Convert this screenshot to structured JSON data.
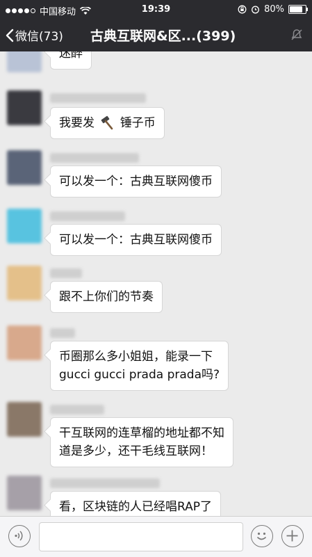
{
  "status_bar": {
    "carrier": "中国移动",
    "time": "19:39",
    "battery": "80%",
    "battery_level": 0.8,
    "signal_bars": 4
  },
  "nav": {
    "back_label": "微信(73)",
    "title": "古典互联网&区...(399)"
  },
  "messages": [
    {
      "text": "迷醉",
      "avatar_color": "#b9c3d6"
    },
    {
      "text": "我要发",
      "text_after_icon": "锤子币",
      "icon": "hammer-icon",
      "avatar_color": "#3a3a40"
    },
    {
      "text": "可以发一个：古典互联网傻币",
      "avatar_color": "#5a6478"
    },
    {
      "text": "可以发一个：古典互联网傻币",
      "avatar_color": "#58c3e0"
    },
    {
      "text": "跟不上你们的节奏",
      "avatar_color": "#e4c08a"
    },
    {
      "text": "币圈那么多小姐姐，能录一下",
      "line2": "gucci gucci prada prada吗?",
      "avatar_color": "#d8a98c"
    },
    {
      "text": "干互联网的连草榴的地址都不知",
      "line2": "道是多少，还干毛线互联网！",
      "avatar_color": "#8a7868"
    },
    {
      "text": "看，区块链的人已经唱RAP了",
      "avatar_color": "#a6a0a8"
    }
  ],
  "colors": {
    "bar_bg": "#2b2b2f",
    "chat_bg": "#ebebeb",
    "bubble_bg": "#ffffff"
  }
}
